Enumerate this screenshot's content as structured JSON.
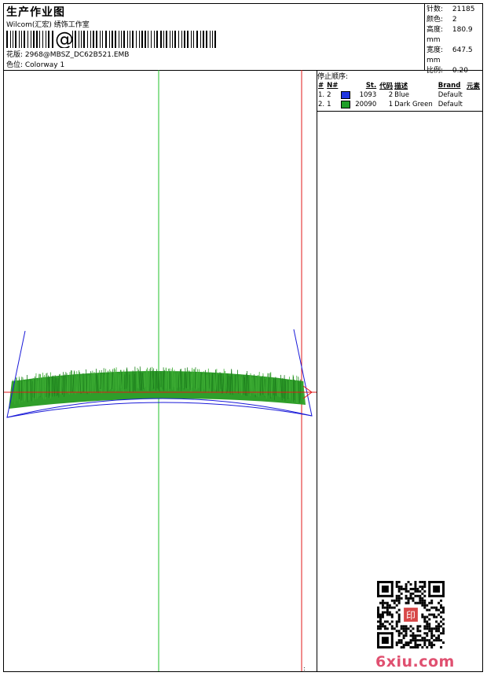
{
  "header": {
    "title": "生产作业图",
    "company": "Wilcom(汇宏) 绣饰工作室",
    "barcode_symbol": "@",
    "design": "花版: 2968@MBSZ_DC62B521.EMB",
    "colorway": "色位: Colorway 1"
  },
  "stats": [
    {
      "label": "针数:",
      "value": "21185"
    },
    {
      "label": "颜色:",
      "value": "2"
    },
    {
      "label": "高度:",
      "value": "180.9 mm"
    },
    {
      "label": "宽度:",
      "value": "647.5 mm"
    },
    {
      "label": "比例:",
      "value": "0.20"
    }
  ],
  "stop_sequence": {
    "heading": "停止顺序:",
    "columns": [
      "#",
      "N#",
      "St.",
      "代码",
      "描述",
      "Brand",
      "元素"
    ],
    "rows": [
      {
        "idx": "1.",
        "n": "2",
        "color": "#1f35e0",
        "stitches": "1093",
        "code": "2",
        "desc": "Blue",
        "brand": "Default"
      },
      {
        "idx": "2.",
        "n": "1",
        "color": "#1f9e28",
        "stitches": "20090",
        "code": "1",
        "desc": "Dark Green",
        "brand": "Default"
      }
    ]
  },
  "watermark": "6xiu.com",
  "qr_stamp": "印"
}
